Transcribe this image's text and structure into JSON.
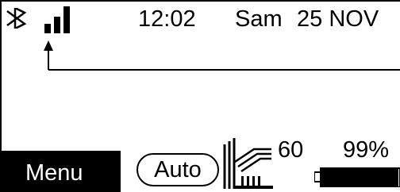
{
  "status_bar": {
    "bluetooth_icon": "bluetooth-icon",
    "signal_icon": "signal-strength-icon",
    "signal_bars_shown": 3,
    "time": "12:02",
    "day": "Sam",
    "date": "25 NOV"
  },
  "softkeys": {
    "menu_label": "Menu"
  },
  "mode": {
    "label": "Auto"
  },
  "heating": {
    "icon": "radiator-heat-icon",
    "value": "60"
  },
  "battery": {
    "icon": "battery-icon",
    "percent": "99%",
    "level": 0.99
  },
  "colors": {
    "background": "#ffffff",
    "foreground": "#000000"
  }
}
